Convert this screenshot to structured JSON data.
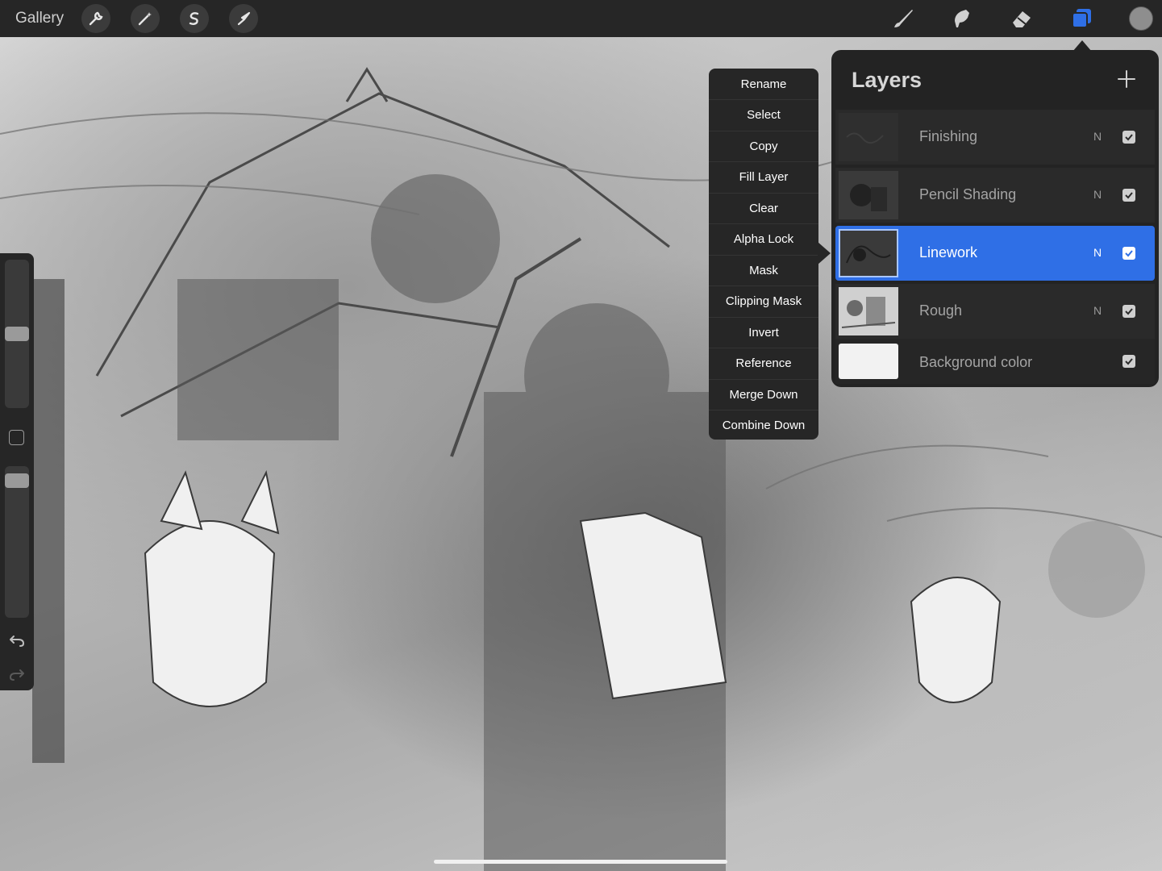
{
  "app": {
    "gallery_label": "Gallery",
    "toolbar_left_icons": [
      "wrench-icon",
      "magic-wand-icon",
      "selection-s-icon",
      "arrow-icon"
    ],
    "toolbar_right_icons": [
      "brush-icon",
      "smudge-icon",
      "eraser-icon",
      "layers-icon"
    ],
    "active_tool_color": "#2f6fe6",
    "current_color": "#8e8e8e"
  },
  "context_menu": {
    "items": [
      "Rename",
      "Select",
      "Copy",
      "Fill Layer",
      "Clear",
      "Alpha Lock",
      "Mask",
      "Clipping Mask",
      "Invert",
      "Reference",
      "Merge Down",
      "Combine Down"
    ]
  },
  "layers_panel": {
    "title": "Layers",
    "add_icon": "plus-icon",
    "selected_color": "#2f6fe6",
    "layers": [
      {
        "name": "Finishing",
        "mode": "N",
        "visible": true,
        "selected": false
      },
      {
        "name": "Pencil Shading",
        "mode": "N",
        "visible": true,
        "selected": false
      },
      {
        "name": "Linework",
        "mode": "N",
        "visible": true,
        "selected": true
      },
      {
        "name": "Rough",
        "mode": "N",
        "visible": true,
        "selected": false
      },
      {
        "name": "Background color",
        "mode": "",
        "visible": true,
        "selected": false
      }
    ]
  },
  "sidebar": {
    "brush_size_level": 0.5,
    "opacity_level": 0.95,
    "icons": [
      "modify-square-icon",
      "undo-icon",
      "redo-icon"
    ]
  }
}
